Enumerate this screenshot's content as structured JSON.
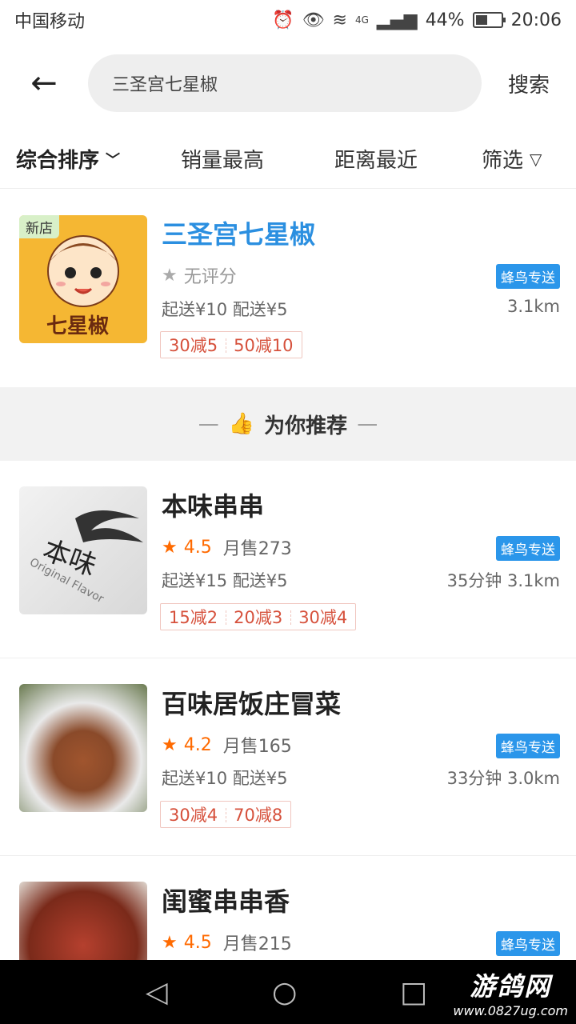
{
  "status_bar": {
    "carrier": "中国移动",
    "network": "4G",
    "battery": "44%",
    "time": "20:06",
    "icons": [
      "alarm-icon",
      "eye-icon",
      "wifi-icon",
      "signal-icon",
      "battery-icon"
    ]
  },
  "header": {
    "back_icon": "←",
    "search_query": "三圣宫七星椒",
    "search_label": "搜索"
  },
  "sort_bar": {
    "items": [
      {
        "label": "综合排序",
        "active": true
      },
      {
        "label": "销量最高"
      },
      {
        "label": "距离最近"
      },
      {
        "label": "筛选"
      }
    ]
  },
  "search_result": {
    "new_tag": "新店",
    "image_text": "七星椒",
    "name": "三圣宫七星椒",
    "rating_text": "无评分",
    "delivery_badge": "蜂鸟专送",
    "delivery": "起送¥10  配送¥5",
    "distance": "3.1km",
    "promos": [
      "30减5",
      "50减10"
    ]
  },
  "recommend": {
    "title": "为你推荐"
  },
  "shops": [
    {
      "name": "本味串串",
      "rating": "4.5",
      "monthly_sales": "月售273",
      "delivery_badge": "蜂鸟专送",
      "delivery": "起送¥15  配送¥5",
      "distance": "35分钟  3.1km",
      "promos": [
        "15减2",
        "20减3",
        "30减4"
      ],
      "image_text": "本味",
      "image_subtext": "Original Flavor"
    },
    {
      "name": "百味居饭庄冒菜",
      "rating": "4.2",
      "monthly_sales": "月售165",
      "delivery_badge": "蜂鸟专送",
      "delivery": "起送¥10  配送¥5",
      "distance": "33分钟  3.0km",
      "promos": [
        "30减4",
        "70减8"
      ]
    },
    {
      "name": "闺蜜串串香",
      "rating": "4.5",
      "monthly_sales": "月售215",
      "delivery_badge": "蜂鸟专送"
    }
  ],
  "watermark": {
    "title": "游鸽网",
    "url": "www.0827ug.com"
  },
  "colors": {
    "accent_blue": "#2b8fe0",
    "star_orange": "#ff6a00",
    "promo_red": "#d6513c",
    "badge_blue": "#2b96ea"
  }
}
